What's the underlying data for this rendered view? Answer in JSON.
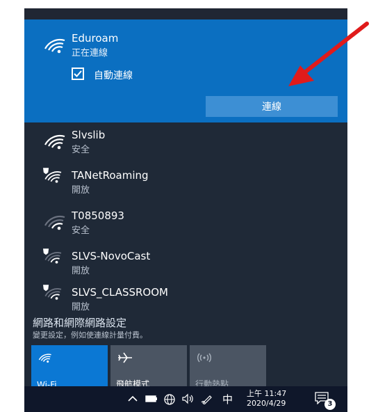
{
  "selected_network": {
    "name": "Eduroam",
    "status": "正在連線",
    "auto_connect_label": "自動連線",
    "auto_connect_checked": true,
    "connect_button": "連線"
  },
  "networks": [
    {
      "name": "Slvslib",
      "status": "安全",
      "secured": true
    },
    {
      "name": "TANetRoaming",
      "status": "開放",
      "secured": false
    },
    {
      "name": "T0850893",
      "status": "安全",
      "secured": true
    },
    {
      "name": "SLVS-NovoCast",
      "status": "開放",
      "secured": false
    },
    {
      "name": "SLVS_CLASSROOM",
      "status": "開放",
      "secured": false
    }
  ],
  "settings": {
    "title": "網路和網際網路設定",
    "subtitle": "變更設定，例如使連線計量付費。"
  },
  "quick_actions": {
    "wifi": "Wi-Fi",
    "airplane": "飛航模式",
    "hotspot": "行動熱點"
  },
  "taskbar": {
    "ime": "中",
    "time": "上午 11:47",
    "date": "2020/4/29",
    "notification_count": "3"
  },
  "colors": {
    "selected_bg": "#0b6fc1",
    "panel_bg": "#1f2937",
    "annotation_arrow": "#e01b1b"
  }
}
